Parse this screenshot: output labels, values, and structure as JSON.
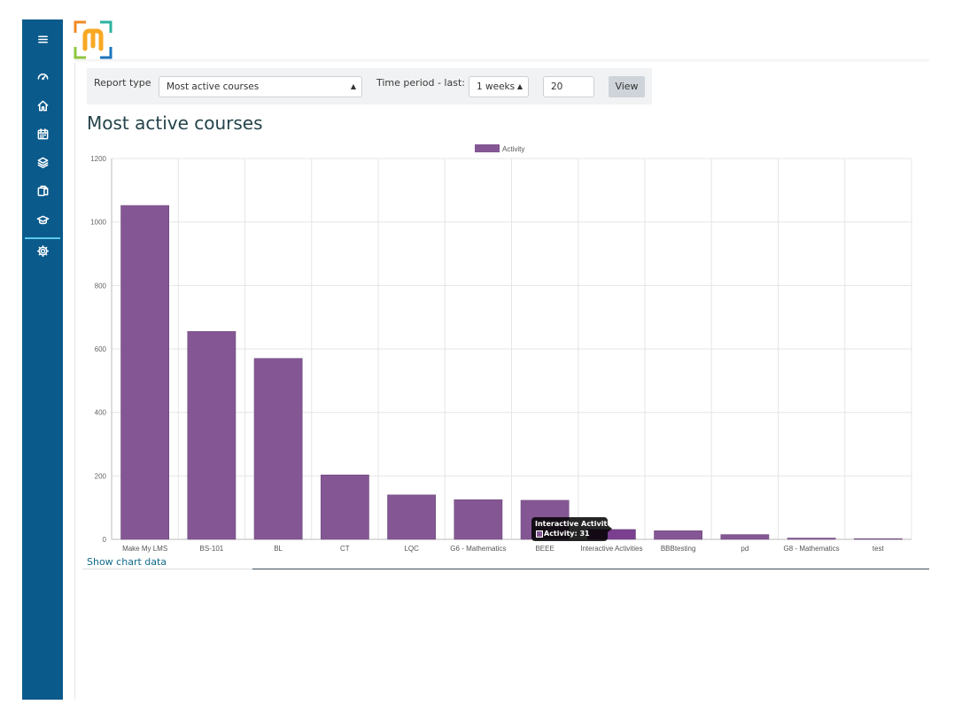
{
  "filters": {
    "report_type_label": "Report type",
    "report_type_value": "Most active courses",
    "time_period_label": "Time period - last:",
    "time_period_value": "1 weeks",
    "count_value": "20",
    "view_button": "View"
  },
  "page_title": "Most active courses",
  "show_chart_data": "Show chart data",
  "sidebar_icons": [
    "menu-icon",
    "dashboard-icon",
    "home-icon",
    "calendar-icon",
    "layers-icon",
    "files-icon",
    "graduation-cap-icon",
    "settings-icon"
  ],
  "colors": {
    "sidebar": "#0a5a8c",
    "bar": "#845794",
    "bar_hover": "#7a3f8f",
    "title": "#24434a",
    "link": "#116a8a"
  },
  "tooltip": {
    "title": "Interactive Activities",
    "body": "Activity: 31"
  },
  "chart_data": {
    "type": "bar",
    "categories": [
      "Make My LMS",
      "BS-101",
      "BL",
      "CT",
      "LQC",
      "G6 - Mathematics",
      "BEEE",
      "Interactive Activities",
      "BBBtesting",
      "pd",
      "G8 - Mathematics",
      "test"
    ],
    "series": [
      {
        "name": "Activity",
        "values": [
          1052,
          655,
          570,
          203,
          140,
          125,
          123,
          31,
          27,
          15,
          4,
          2
        ]
      }
    ],
    "ylim": [
      0,
      1200
    ],
    "yticks": [
      0,
      200,
      400,
      600,
      800,
      1000,
      1200
    ],
    "grid": true,
    "legend": "top-center",
    "highlighted_index": 7
  }
}
